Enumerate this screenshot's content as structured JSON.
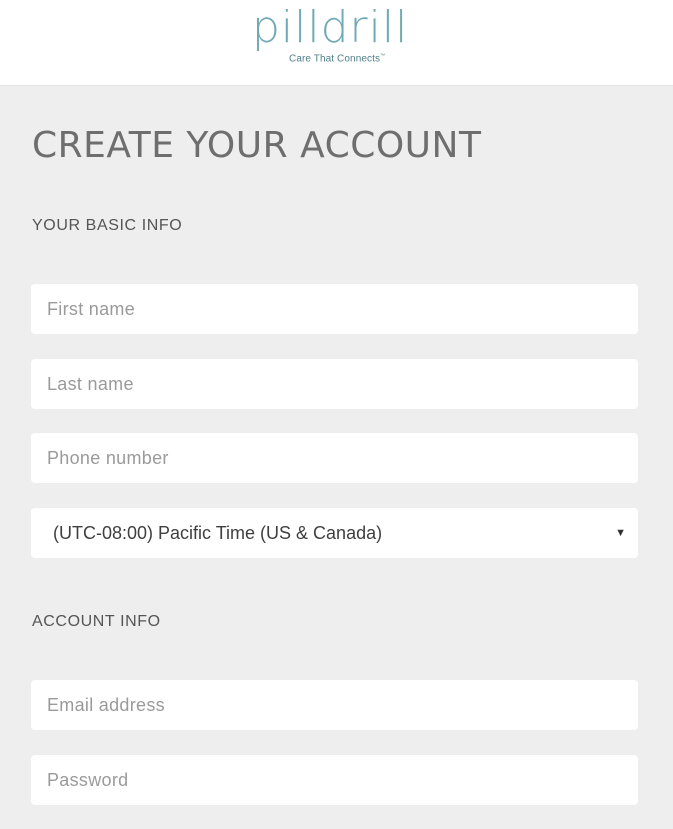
{
  "brand": {
    "logo_text": "pilldrill",
    "tagline": "Care That Connects",
    "tagline_mark": "™",
    "logo_color": "#6fa9b5"
  },
  "form": {
    "title": "CREATE YOUR ACCOUNT",
    "basic_info": {
      "heading": "YOUR BASIC INFO",
      "first_name": {
        "placeholder": "First name",
        "value": ""
      },
      "last_name": {
        "placeholder": "Last name",
        "value": ""
      },
      "phone": {
        "placeholder": "Phone number",
        "value": ""
      },
      "timezone": {
        "selected": "(UTC-08:00) Pacific Time (US & Canada)",
        "caret": "▼"
      }
    },
    "account_info": {
      "heading": "ACCOUNT INFO",
      "email": {
        "placeholder": "Email address",
        "value": ""
      },
      "password": {
        "placeholder": "Password",
        "value": ""
      }
    }
  },
  "colors": {
    "panel_background": "#eeeeee",
    "field_background": "#ffffff",
    "title_text": "#6e6e6e"
  }
}
